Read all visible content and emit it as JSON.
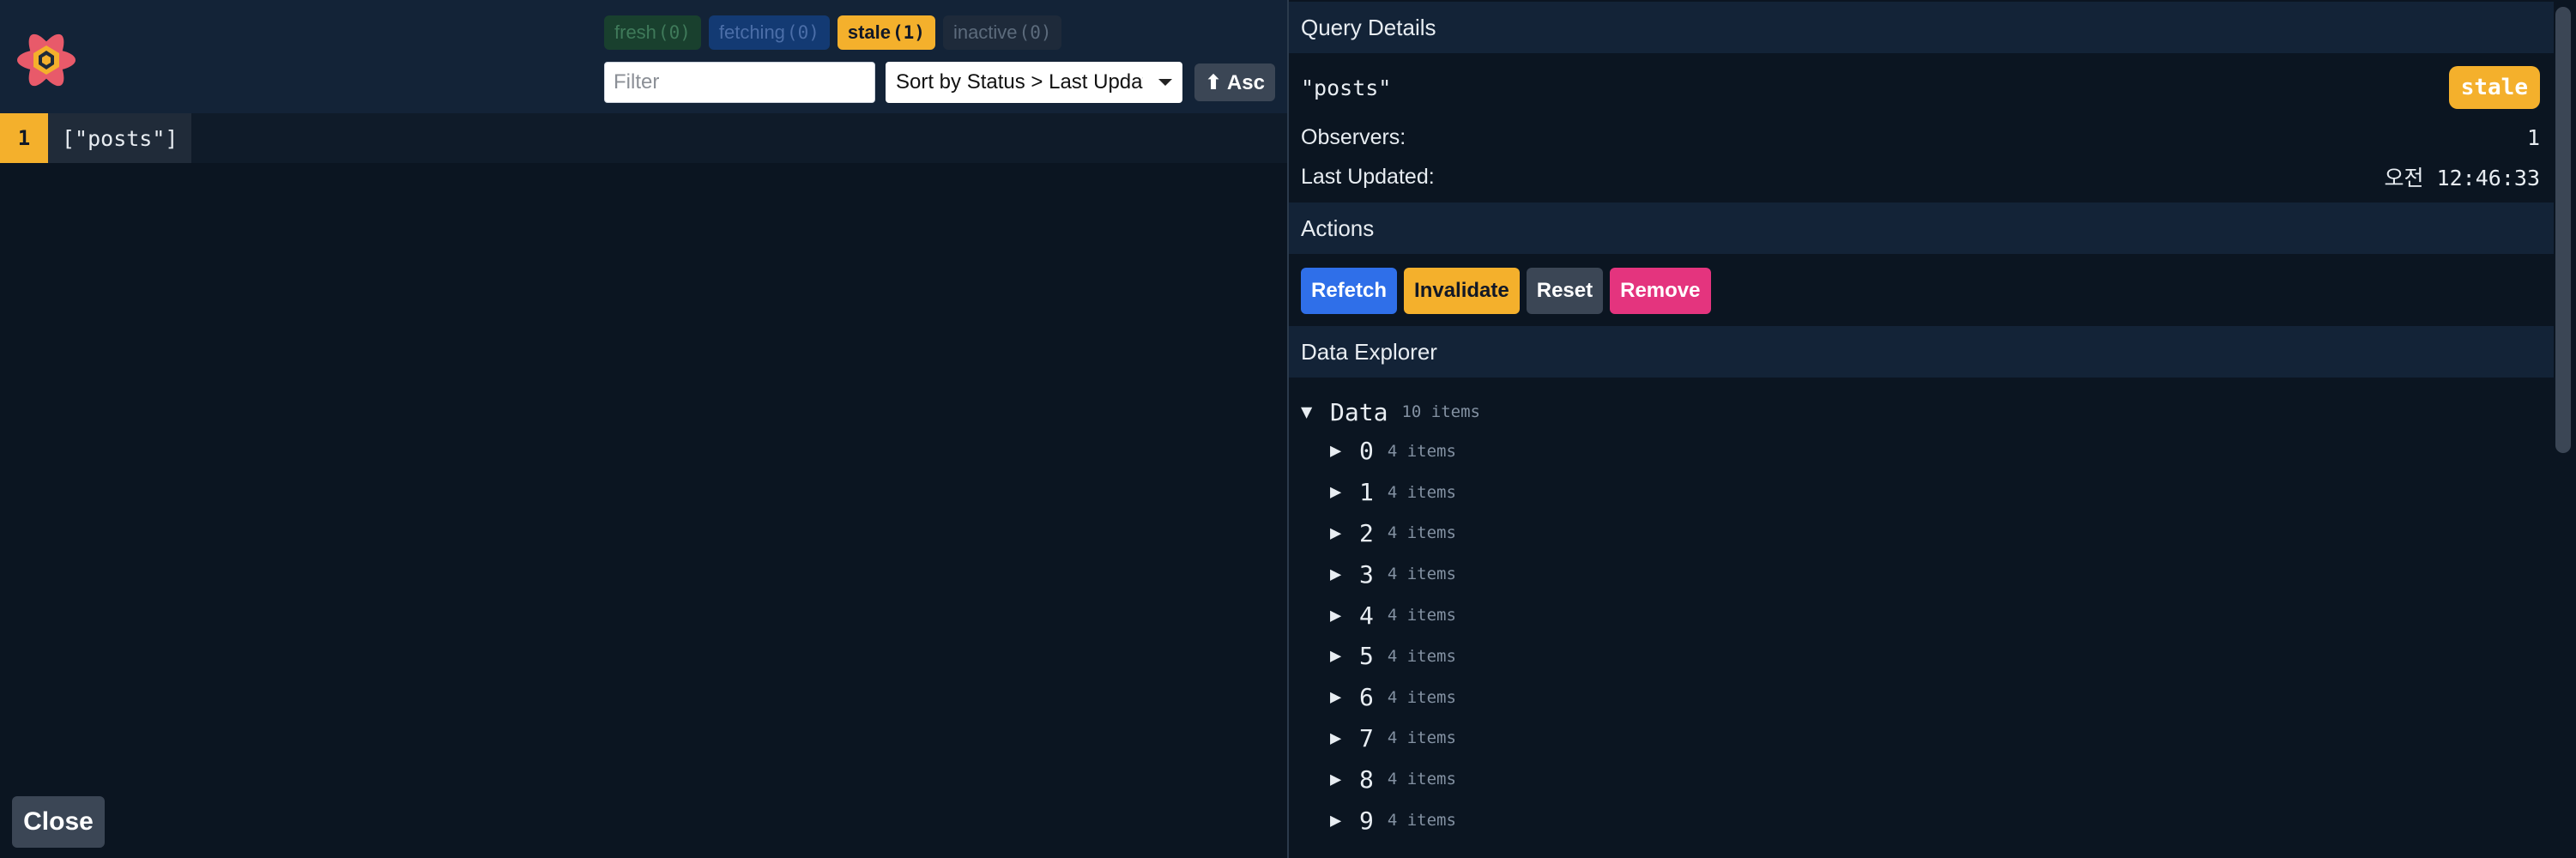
{
  "header": {
    "badges": [
      {
        "label": "fresh",
        "count": "(0)"
      },
      {
        "label": "fetching",
        "count": "(0)"
      },
      {
        "label": "stale",
        "count": "(1)"
      },
      {
        "label": "inactive",
        "count": "(0)"
      }
    ],
    "filter": {
      "placeholder": "Filter"
    },
    "sort": {
      "selected": "Sort by Status > Last Updated"
    },
    "asc_label": "⬆ Asc"
  },
  "query_list": [
    {
      "count": "1",
      "key": "[\"posts\"]"
    }
  ],
  "close_label": "Close",
  "details": {
    "section_title": "Query Details",
    "query_hash": "\"posts\"",
    "status": "stale",
    "observers_label": "Observers:",
    "observers_value": "1",
    "updated_label": "Last Updated:",
    "updated_value": "오전 12:46:33"
  },
  "actions": {
    "section_title": "Actions",
    "refetch": "Refetch",
    "invalidate": "Invalidate",
    "reset": "Reset",
    "remove": "Remove"
  },
  "explorer": {
    "section_title": "Data Explorer",
    "root_label": "Data",
    "root_count": "10 items",
    "items": [
      {
        "key": "0",
        "count": "4 items"
      },
      {
        "key": "1",
        "count": "4 items"
      },
      {
        "key": "2",
        "count": "4 items"
      },
      {
        "key": "3",
        "count": "4 items"
      },
      {
        "key": "4",
        "count": "4 items"
      },
      {
        "key": "5",
        "count": "4 items"
      },
      {
        "key": "6",
        "count": "4 items"
      },
      {
        "key": "7",
        "count": "4 items"
      },
      {
        "key": "8",
        "count": "4 items"
      },
      {
        "key": "9",
        "count": "4 items"
      }
    ]
  },
  "colors": {
    "stale": "#f4b02c",
    "refetch": "#2f6fe9",
    "remove": "#e4347e",
    "panel_bg": "#0b1521",
    "header_bg": "#132337"
  },
  "icons": {
    "logo": "react-query-logo-icon",
    "collapsed": "triangle-right-icon",
    "expanded": "triangle-down-icon",
    "sort_direction": "arrow-up-icon"
  }
}
